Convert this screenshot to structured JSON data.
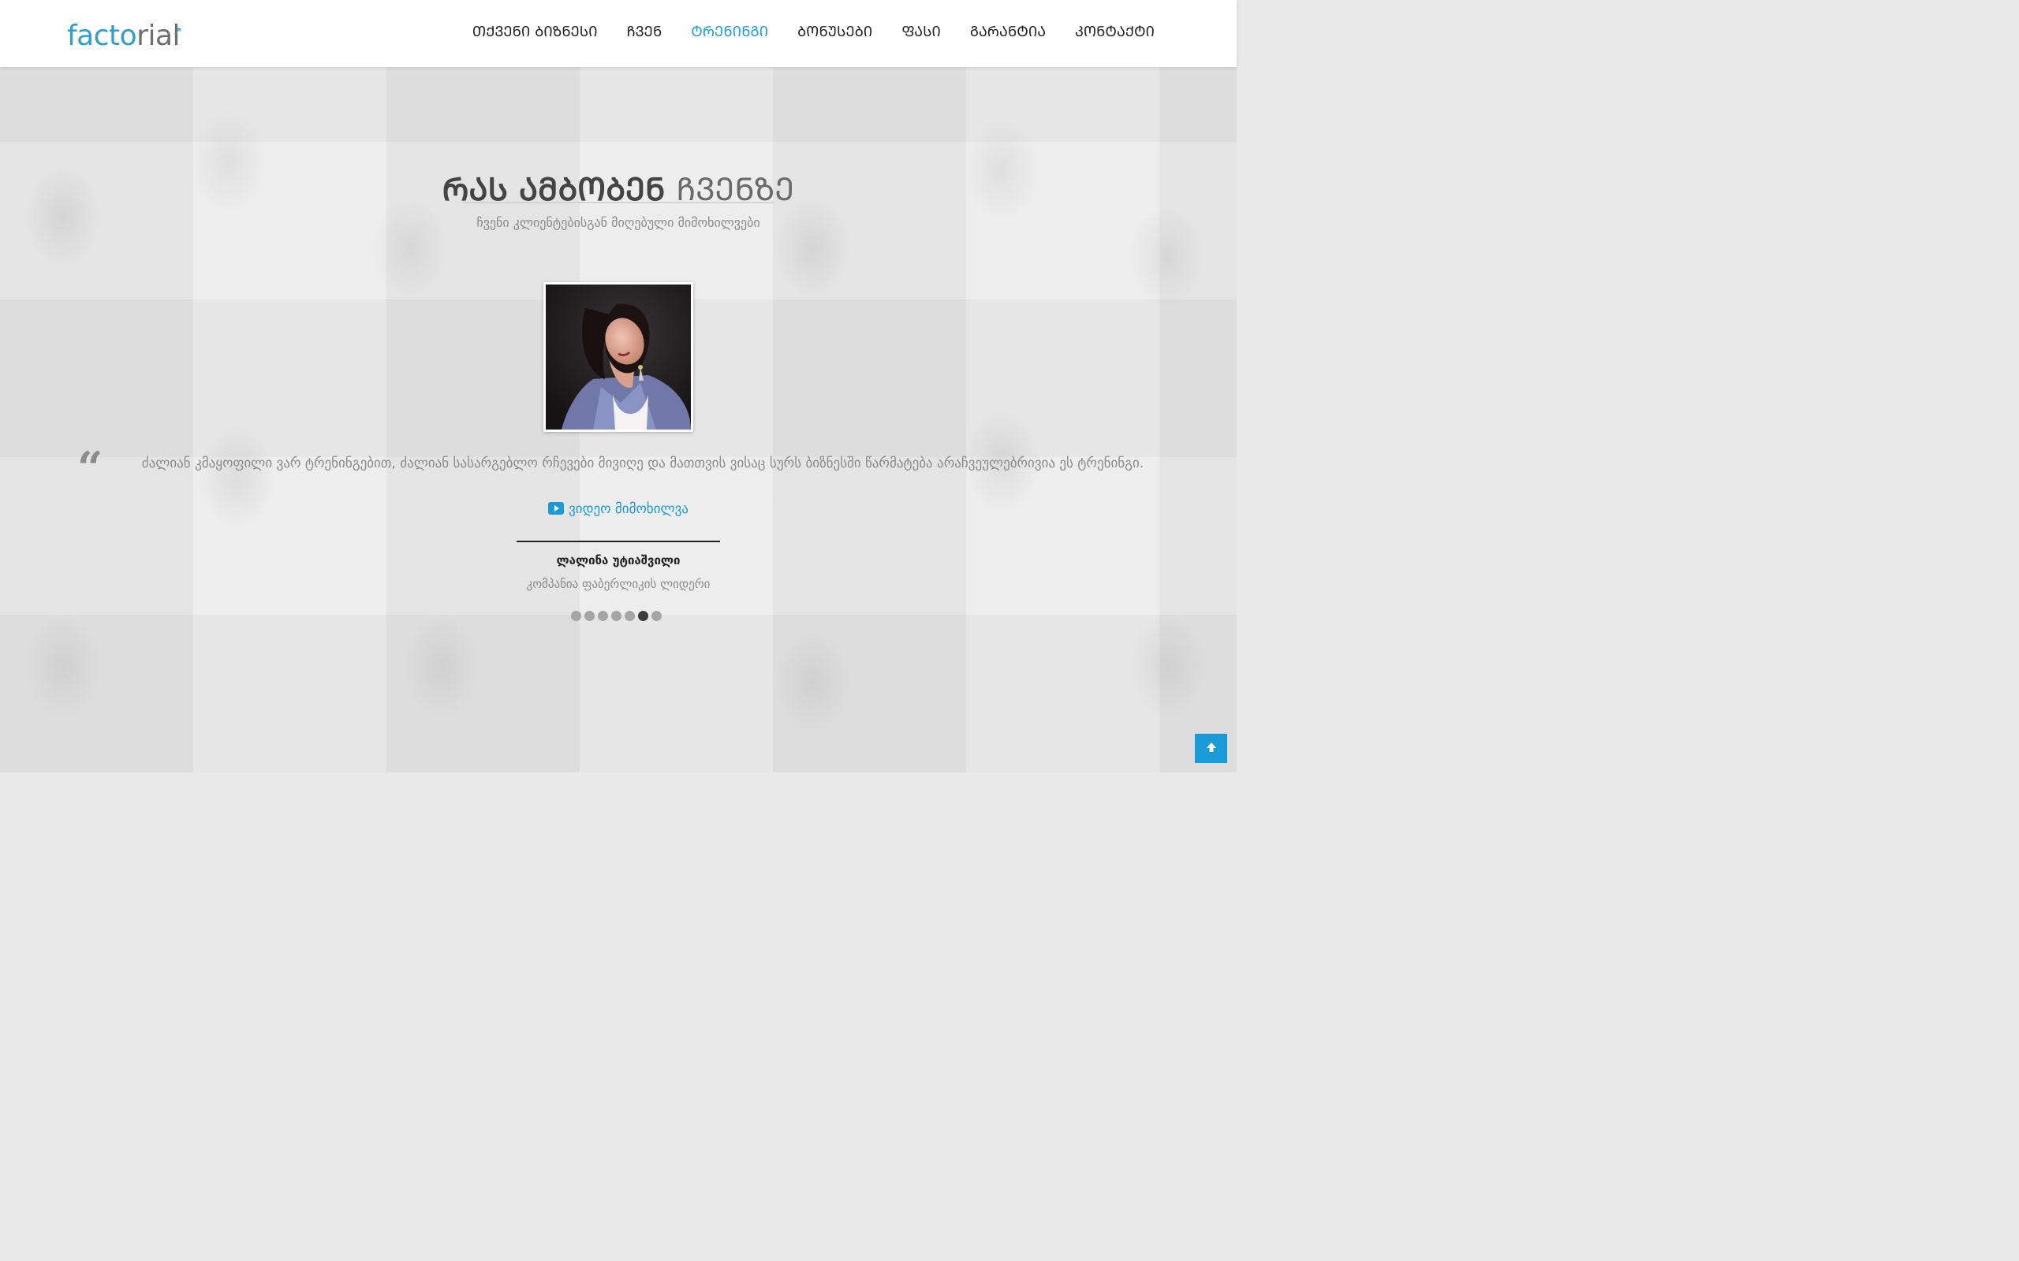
{
  "brand": {
    "logo_part1": "facto",
    "logo_part2": "rial",
    "logo_arrow": "↗",
    "accent_color": "#1a9ad6"
  },
  "nav": {
    "items": [
      {
        "label": "ᲗᲥᲕᲔᲜᲘ ᲑᲘᲖᲜᲔᲡᲘ",
        "active": false
      },
      {
        "label": "ᲩᲕᲔᲜ",
        "active": false
      },
      {
        "label": "ᲢᲠᲔᲜᲘᲜᲒᲘ",
        "active": true
      },
      {
        "label": "ᲑᲝᲜᲣᲡᲔᲑᲘ",
        "active": false
      },
      {
        "label": "ᲤᲐᲡᲘ",
        "active": false
      },
      {
        "label": "ᲒᲐᲠᲐᲜᲢᲘᲐ",
        "active": false
      },
      {
        "label": "ᲙᲝᲜᲢᲐᲥᲢᲘ",
        "active": false
      }
    ]
  },
  "section": {
    "title_strong": "ᲠᲐᲡ ᲐᲛᲑᲝᲑᲔᲜ",
    "title_light": "ᲩᲕᲔᲜᲖᲔ",
    "subtitle": "ჩვენი კლიენტებისგან მიღებული მიმოხილვები"
  },
  "testimonial": {
    "quote_icon": "“",
    "quote": "ძალიან კმაყოფილი ვარ ტრენინგებით, ძალიან სასარგებლო რჩევები მივიღე და მათთვის ვისაც სურს ბიზნესში წარმატება არაჩვეულებრივია ეს ტრენინგი.",
    "video_icon": "youtube-play-icon",
    "video_label": "ვიდეო მიმოხილვა",
    "author_name": "ლალინა უტიაშვილი",
    "author_role": "კომპანია ფაბერლიკის ლიდერი"
  },
  "carousel": {
    "total": 7,
    "active_index": 5
  },
  "scroll_top": {
    "icon": "arrow-up-icon"
  }
}
